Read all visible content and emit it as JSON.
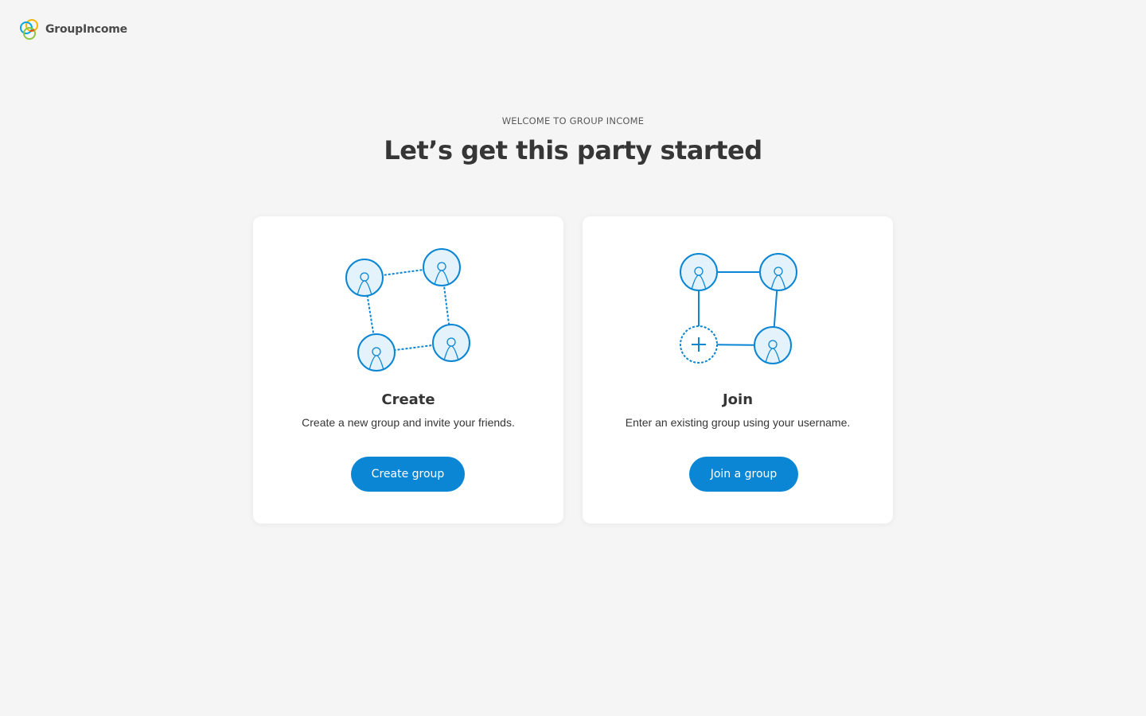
{
  "brand": {
    "name": "GroupIncome",
    "logo_icon": "groupincome-logo-icon",
    "logo_colors": [
      "#f7b500",
      "#e94e1b",
      "#8dc63f",
      "#00a7e1"
    ]
  },
  "intro": {
    "kicker": "WELCOME TO GROUP INCOME",
    "headline": "Let’s get this party started"
  },
  "accent_color": "#0a86d4",
  "cards": {
    "create": {
      "illustration": "group-network-illustration",
      "title": "Create",
      "description": "Create a new group and invite your friends.",
      "button_label": "Create group"
    },
    "join": {
      "illustration": "join-network-illustration",
      "title": "Join",
      "description": "Enter an existing group using your username.",
      "button_label": "Join a group"
    }
  }
}
